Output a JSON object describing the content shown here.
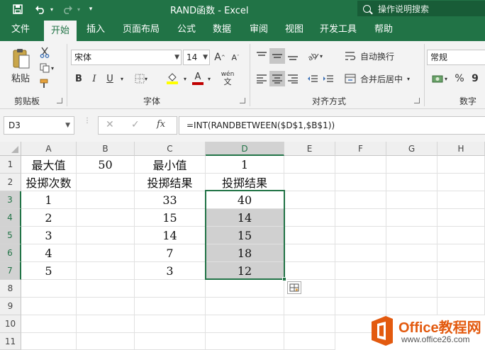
{
  "titlebar": {
    "title": "RAND函数  -  Excel",
    "tell_me": "操作说明搜索",
    "undo_icon": "undo-icon",
    "redo_icon": "redo-icon"
  },
  "tabs": [
    {
      "label": "文件"
    },
    {
      "label": "开始"
    },
    {
      "label": "插入"
    },
    {
      "label": "页面布局"
    },
    {
      "label": "公式"
    },
    {
      "label": "数据"
    },
    {
      "label": "审阅"
    },
    {
      "label": "视图"
    },
    {
      "label": "开发工具"
    },
    {
      "label": "帮助"
    }
  ],
  "ribbon": {
    "clipboard": {
      "paste_label": "粘贴",
      "group_label": "剪贴板"
    },
    "font": {
      "name": "宋体",
      "size": "14",
      "bold": "B",
      "italic": "I",
      "underline": "U",
      "grow": "A",
      "shrink": "A",
      "color_a": "A",
      "wen": "wén",
      "group_label": "字体"
    },
    "alignment": {
      "wrap_text": "自动换行",
      "merge_center": "合并后居中",
      "group_label": "对齐方式"
    },
    "number": {
      "format": "常规",
      "percent": "%",
      "comma": "9",
      "group_label": "数字"
    }
  },
  "formula_bar": {
    "name_box": "D3",
    "cancel": "✕",
    "enter": "✓",
    "fx": "fx",
    "formula": "=INT(RANDBETWEEN($D$1,$B$1))"
  },
  "sheet": {
    "columns": [
      "A",
      "B",
      "C",
      "D",
      "E",
      "F",
      "G",
      "H"
    ],
    "rows": [
      "1",
      "2",
      "3",
      "4",
      "5",
      "6",
      "7",
      "8",
      "9",
      "10",
      "11"
    ],
    "active_cell": "D3",
    "cells": {
      "A1": "最大值",
      "B1": "50",
      "C1": "最小值",
      "D1": "1",
      "A2": "投掷次数",
      "C2": "投掷结果",
      "D2": "投掷结果",
      "A3": "1",
      "C3": "33",
      "D3": "40",
      "A4": "2",
      "C4": "15",
      "D4": "14",
      "A5": "3",
      "C5": "14",
      "D5": "15",
      "A6": "4",
      "C6": "7",
      "D6": "18",
      "A7": "5",
      "C7": "3",
      "D7": "12"
    }
  },
  "watermark": {
    "brand": "Office教程网",
    "url": "www.office26.com"
  },
  "colors": {
    "excel_green": "#217346",
    "selection_gray": "#d0d0d0",
    "watermark_orange": "#e35a0f"
  }
}
